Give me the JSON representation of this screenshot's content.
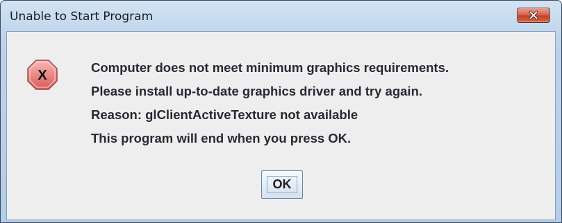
{
  "window": {
    "title": "Unable to Start Program",
    "close_icon": "close-icon"
  },
  "dialog": {
    "icon": "error-x-octagon-icon",
    "messages": [
      "Computer does not meet minimum graphics requirements.",
      "Please install up-to-date graphics driver and try again.",
      "Reason: glClientActiveTexture not available",
      "This program will end when you press OK."
    ],
    "ok_label": "OK"
  },
  "colors": {
    "title_bar": "#bcd3ec",
    "client_bg": "#eeeeee",
    "close_button": "#c24128",
    "error_icon": "#e4737a"
  }
}
